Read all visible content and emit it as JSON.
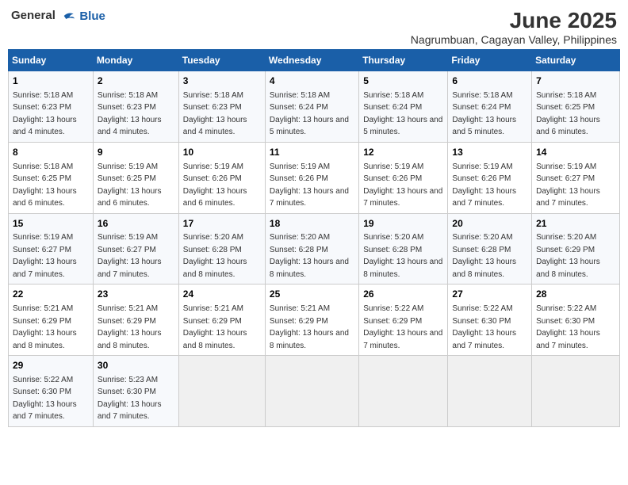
{
  "logo": {
    "general": "General",
    "blue": "Blue"
  },
  "title": "June 2025",
  "subtitle": "Nagrumbuan, Cagayan Valley, Philippines",
  "days_of_week": [
    "Sunday",
    "Monday",
    "Tuesday",
    "Wednesday",
    "Thursday",
    "Friday",
    "Saturday"
  ],
  "weeks": [
    [
      {
        "day": "1",
        "sunrise": "Sunrise: 5:18 AM",
        "sunset": "Sunset: 6:23 PM",
        "daylight": "Daylight: 13 hours and 4 minutes."
      },
      {
        "day": "2",
        "sunrise": "Sunrise: 5:18 AM",
        "sunset": "Sunset: 6:23 PM",
        "daylight": "Daylight: 13 hours and 4 minutes."
      },
      {
        "day": "3",
        "sunrise": "Sunrise: 5:18 AM",
        "sunset": "Sunset: 6:23 PM",
        "daylight": "Daylight: 13 hours and 4 minutes."
      },
      {
        "day": "4",
        "sunrise": "Sunrise: 5:18 AM",
        "sunset": "Sunset: 6:24 PM",
        "daylight": "Daylight: 13 hours and 5 minutes."
      },
      {
        "day": "5",
        "sunrise": "Sunrise: 5:18 AM",
        "sunset": "Sunset: 6:24 PM",
        "daylight": "Daylight: 13 hours and 5 minutes."
      },
      {
        "day": "6",
        "sunrise": "Sunrise: 5:18 AM",
        "sunset": "Sunset: 6:24 PM",
        "daylight": "Daylight: 13 hours and 5 minutes."
      },
      {
        "day": "7",
        "sunrise": "Sunrise: 5:18 AM",
        "sunset": "Sunset: 6:25 PM",
        "daylight": "Daylight: 13 hours and 6 minutes."
      }
    ],
    [
      {
        "day": "8",
        "sunrise": "Sunrise: 5:18 AM",
        "sunset": "Sunset: 6:25 PM",
        "daylight": "Daylight: 13 hours and 6 minutes."
      },
      {
        "day": "9",
        "sunrise": "Sunrise: 5:19 AM",
        "sunset": "Sunset: 6:25 PM",
        "daylight": "Daylight: 13 hours and 6 minutes."
      },
      {
        "day": "10",
        "sunrise": "Sunrise: 5:19 AM",
        "sunset": "Sunset: 6:26 PM",
        "daylight": "Daylight: 13 hours and 6 minutes."
      },
      {
        "day": "11",
        "sunrise": "Sunrise: 5:19 AM",
        "sunset": "Sunset: 6:26 PM",
        "daylight": "Daylight: 13 hours and 7 minutes."
      },
      {
        "day": "12",
        "sunrise": "Sunrise: 5:19 AM",
        "sunset": "Sunset: 6:26 PM",
        "daylight": "Daylight: 13 hours and 7 minutes."
      },
      {
        "day": "13",
        "sunrise": "Sunrise: 5:19 AM",
        "sunset": "Sunset: 6:26 PM",
        "daylight": "Daylight: 13 hours and 7 minutes."
      },
      {
        "day": "14",
        "sunrise": "Sunrise: 5:19 AM",
        "sunset": "Sunset: 6:27 PM",
        "daylight": "Daylight: 13 hours and 7 minutes."
      }
    ],
    [
      {
        "day": "15",
        "sunrise": "Sunrise: 5:19 AM",
        "sunset": "Sunset: 6:27 PM",
        "daylight": "Daylight: 13 hours and 7 minutes."
      },
      {
        "day": "16",
        "sunrise": "Sunrise: 5:19 AM",
        "sunset": "Sunset: 6:27 PM",
        "daylight": "Daylight: 13 hours and 7 minutes."
      },
      {
        "day": "17",
        "sunrise": "Sunrise: 5:20 AM",
        "sunset": "Sunset: 6:28 PM",
        "daylight": "Daylight: 13 hours and 8 minutes."
      },
      {
        "day": "18",
        "sunrise": "Sunrise: 5:20 AM",
        "sunset": "Sunset: 6:28 PM",
        "daylight": "Daylight: 13 hours and 8 minutes."
      },
      {
        "day": "19",
        "sunrise": "Sunrise: 5:20 AM",
        "sunset": "Sunset: 6:28 PM",
        "daylight": "Daylight: 13 hours and 8 minutes."
      },
      {
        "day": "20",
        "sunrise": "Sunrise: 5:20 AM",
        "sunset": "Sunset: 6:28 PM",
        "daylight": "Daylight: 13 hours and 8 minutes."
      },
      {
        "day": "21",
        "sunrise": "Sunrise: 5:20 AM",
        "sunset": "Sunset: 6:29 PM",
        "daylight": "Daylight: 13 hours and 8 minutes."
      }
    ],
    [
      {
        "day": "22",
        "sunrise": "Sunrise: 5:21 AM",
        "sunset": "Sunset: 6:29 PM",
        "daylight": "Daylight: 13 hours and 8 minutes."
      },
      {
        "day": "23",
        "sunrise": "Sunrise: 5:21 AM",
        "sunset": "Sunset: 6:29 PM",
        "daylight": "Daylight: 13 hours and 8 minutes."
      },
      {
        "day": "24",
        "sunrise": "Sunrise: 5:21 AM",
        "sunset": "Sunset: 6:29 PM",
        "daylight": "Daylight: 13 hours and 8 minutes."
      },
      {
        "day": "25",
        "sunrise": "Sunrise: 5:21 AM",
        "sunset": "Sunset: 6:29 PM",
        "daylight": "Daylight: 13 hours and 8 minutes."
      },
      {
        "day": "26",
        "sunrise": "Sunrise: 5:22 AM",
        "sunset": "Sunset: 6:29 PM",
        "daylight": "Daylight: 13 hours and 7 minutes."
      },
      {
        "day": "27",
        "sunrise": "Sunrise: 5:22 AM",
        "sunset": "Sunset: 6:30 PM",
        "daylight": "Daylight: 13 hours and 7 minutes."
      },
      {
        "day": "28",
        "sunrise": "Sunrise: 5:22 AM",
        "sunset": "Sunset: 6:30 PM",
        "daylight": "Daylight: 13 hours and 7 minutes."
      }
    ],
    [
      {
        "day": "29",
        "sunrise": "Sunrise: 5:22 AM",
        "sunset": "Sunset: 6:30 PM",
        "daylight": "Daylight: 13 hours and 7 minutes."
      },
      {
        "day": "30",
        "sunrise": "Sunrise: 5:23 AM",
        "sunset": "Sunset: 6:30 PM",
        "daylight": "Daylight: 13 hours and 7 minutes."
      },
      null,
      null,
      null,
      null,
      null
    ]
  ]
}
